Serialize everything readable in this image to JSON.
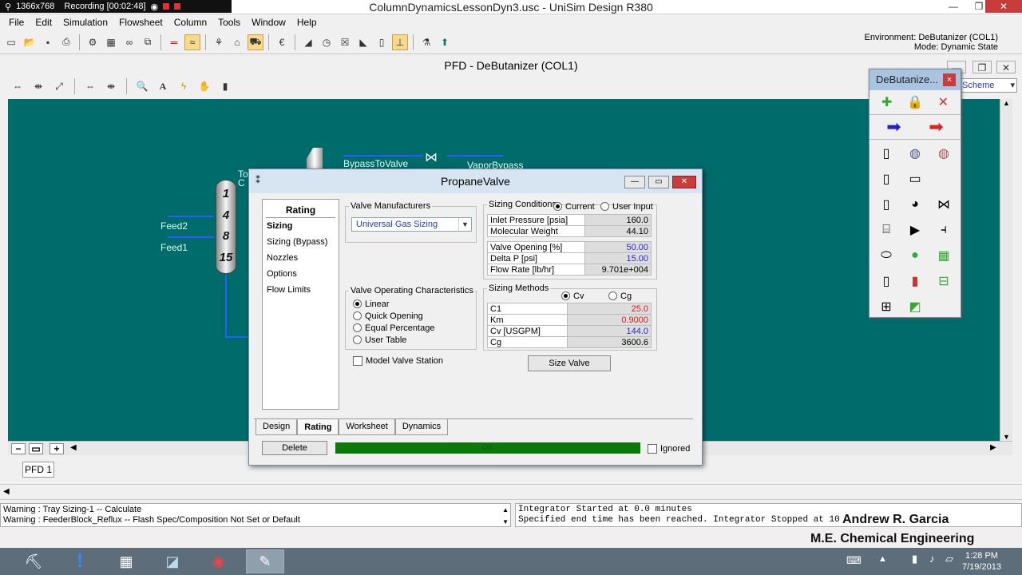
{
  "window": {
    "title": "ColumnDynamicsLessonDyn3.usc - UniSim Design R380",
    "recording_res": "1366x768",
    "recording_label": "Recording [00:02:48]"
  },
  "menu": [
    "File",
    "Edit",
    "Simulation",
    "Flowsheet",
    "Column",
    "Tools",
    "Window",
    "Help"
  ],
  "environment": {
    "line1": "Environment: DeButanizer (COL1)",
    "line2": "Mode: Dynamic State"
  },
  "pfd": {
    "title": "PFD - DeButanizer (COL1)",
    "tab": "PFD 1",
    "scheme_label": "Scheme",
    "streams": {
      "feed1": "Feed1",
      "feed2": "Feed2",
      "bypass": "BypassToValve",
      "vapor": "VaporBypass",
      "to_label_1": "To",
      "to_label_2": "C"
    },
    "stages": [
      "1",
      "4",
      "8",
      "15"
    ]
  },
  "palette": {
    "title": "DeButanize...",
    "close": "×"
  },
  "dialog": {
    "title": "PropaneValve",
    "nav": {
      "header": "Rating",
      "items": [
        "Sizing",
        "Sizing (Bypass)",
        "Nozzles",
        "Options",
        "Flow Limits"
      ]
    },
    "valve_manufacturers": {
      "legend": "Valve Manufacturers",
      "selected": "Universal Gas Sizing"
    },
    "valve_operating": {
      "legend": "Valve Operating Characteristics",
      "options": [
        "Linear",
        "Quick Opening",
        "Equal Percentage",
        "User Table"
      ]
    },
    "model_valve_station": "Model Valve Station",
    "sizing_conditions": {
      "legend": "Sizing Conditions",
      "opt_current": "Current",
      "opt_user": "User Input",
      "rows1": [
        {
          "k": "Inlet Pressure [psia]",
          "v": "160.0"
        },
        {
          "k": "Molecular Weight",
          "v": "44.10"
        }
      ],
      "rows2": [
        {
          "k": "Valve Opening [%]",
          "v": "50.00"
        },
        {
          "k": "Delta P [psi]",
          "v": "15.00"
        },
        {
          "k": "Flow Rate [lb/hr]",
          "v": "9.701e+004"
        }
      ]
    },
    "sizing_methods": {
      "legend": "Sizing Methods",
      "opt_cv": "Cv",
      "opt_cg": "Cg",
      "rows": [
        {
          "k": "C1",
          "v": "25.0"
        },
        {
          "k": "Km",
          "v": "0.9000"
        },
        {
          "k": "Cv [USGPM]",
          "v": "144.0"
        },
        {
          "k": "Cg",
          "v": "3600.6"
        }
      ]
    },
    "size_valve": "Size Valve",
    "tabs": [
      "Design",
      "Rating",
      "Worksheet",
      "Dynamics"
    ],
    "delete": "Delete",
    "status": "OK",
    "ignored": "Ignored"
  },
  "messages": {
    "left": [
      "Warning : Tray Sizing-1 -- Calculate",
      "Warning : FeederBlock_Reflux -- Flash Spec/Composition Not Set or Default"
    ],
    "right": [
      "Integrator Started at 0.0 minutes",
      "Specified end time has been reached. Integrator Stopped at 10"
    ]
  },
  "credit": {
    "name": "Andrew R. Garcia",
    "subtitle": "M.E. Chemical Engineering"
  },
  "clock": {
    "time": "1:28 PM",
    "date": "7/19/2013"
  },
  "colors": {
    "canvas": "#006b6b",
    "ok_bar": "#0b7a0b",
    "stream": "#2a5cff"
  }
}
